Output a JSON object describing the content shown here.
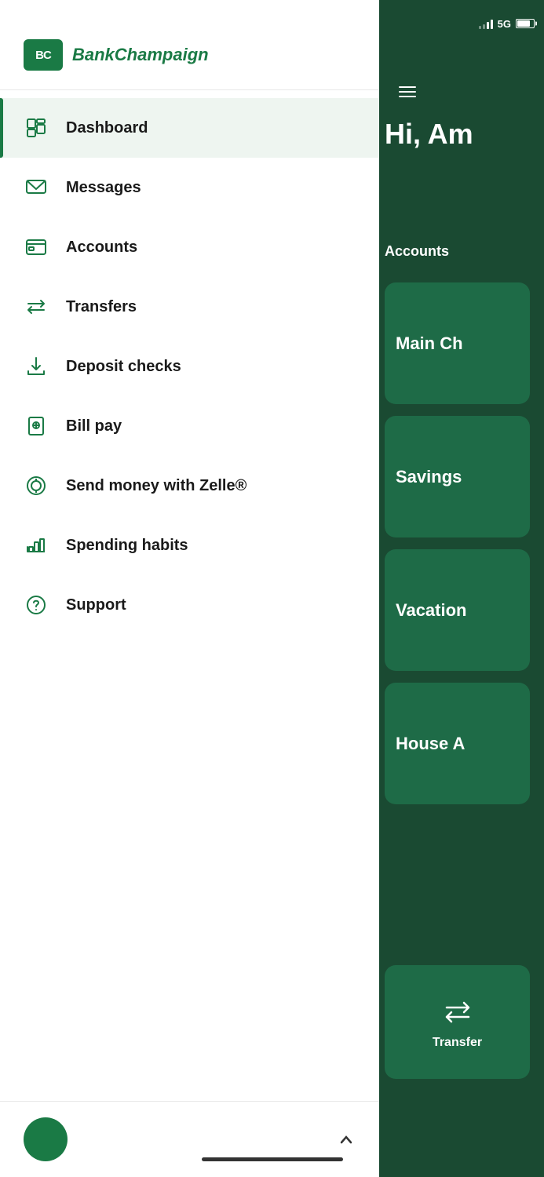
{
  "statusBar": {
    "network": "5G"
  },
  "rightPanel": {
    "greeting": "Hi, Am",
    "accountsLabel": "Accounts",
    "accounts": [
      {
        "id": "main-ch",
        "label": "Main Ch"
      },
      {
        "id": "savings",
        "label": "Savings"
      },
      {
        "id": "vacation",
        "label": "Vacation"
      },
      {
        "id": "house",
        "label": "House A"
      }
    ],
    "transferLabel": "Transfer"
  },
  "sidebar": {
    "logo": {
      "initials": "BC",
      "name": "Bank",
      "nameCursive": "Champaign"
    },
    "navItems": [
      {
        "id": "dashboard",
        "label": "Dashboard",
        "icon": "dashboard-icon",
        "active": true
      },
      {
        "id": "messages",
        "label": "Messages",
        "icon": "messages-icon",
        "active": false
      },
      {
        "id": "accounts",
        "label": "Accounts",
        "icon": "accounts-icon",
        "active": false
      },
      {
        "id": "transfers",
        "label": "Transfers",
        "icon": "transfers-icon",
        "active": false
      },
      {
        "id": "deposit-checks",
        "label": "Deposit checks",
        "icon": "deposit-icon",
        "active": false
      },
      {
        "id": "bill-pay",
        "label": "Bill pay",
        "icon": "bill-icon",
        "active": false
      },
      {
        "id": "zelle",
        "label": "Send money with Zelle®",
        "icon": "zelle-icon",
        "active": false
      },
      {
        "id": "spending",
        "label": "Spending habits",
        "icon": "spending-icon",
        "active": false
      },
      {
        "id": "support",
        "label": "Support",
        "icon": "support-icon",
        "active": false
      }
    ]
  }
}
